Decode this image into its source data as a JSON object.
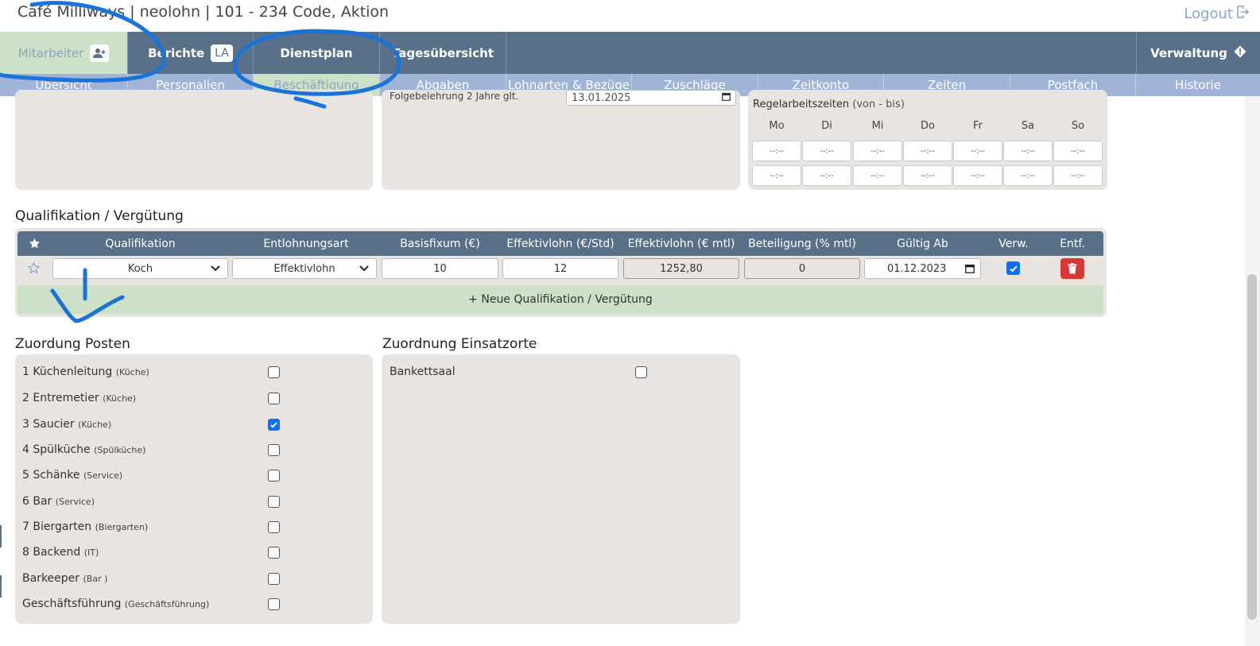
{
  "header": {
    "title": "Café Milliways | neolohn | 101 - 234 Code, Aktion",
    "logout_label": "Logout"
  },
  "mainnav": {
    "mitarbeiter": "Mitarbeiter",
    "berichte": "Berichte",
    "berichte_badge": "LA",
    "dienstplan": "Dienstplan",
    "tagesuebersicht": "Tagesübersicht",
    "verwaltung": "Verwaltung"
  },
  "subnav": [
    "Übersicht",
    "Personalien",
    "Beschäftigung",
    "Abgaben",
    "Lohnarten & Bezüge",
    "Zuschläge",
    "Zeitkonto",
    "Zeiten",
    "Postfach",
    "Historie"
  ],
  "top_fragment": {
    "label": "Folgebelehrung 2 Jahre glt.",
    "date": "13.01.2025"
  },
  "regelarbeitszeiten": {
    "title": "Regelarbeitszeiten",
    "suffix": "(von - bis)",
    "days": [
      "Mo",
      "Di",
      "Mi",
      "Do",
      "Fr",
      "Sa",
      "So"
    ],
    "placeholder": "--:--"
  },
  "qualifikation": {
    "section_title": "Qualifikation / Vergütung",
    "headers": {
      "qualifikation": "Qualifikation",
      "entlohnungsart": "Entlohnungsart",
      "basisfixum": "Basisfixum (€)",
      "effektivlohn_std": "Effektivlohn (€/Std)",
      "effektivlohn_mtl": "Effektivlohn (€ mtl)",
      "beteiligung": "Beteiligung (% mtl)",
      "gueltig_ab": "Gültig Ab",
      "verw": "Verw.",
      "entf": "Entf."
    },
    "row": {
      "qualifikation": "Koch",
      "entlohnungsart": "Effektivlohn",
      "basisfixum": "10",
      "effektivlohn_std": "12",
      "effektivlohn_mtl": "1252,80",
      "beteiligung": "0",
      "gueltig_ab": "01.12.2023",
      "verw_checked": true
    },
    "add_label": "+ Neue Qualifikation / Vergütung"
  },
  "posten": {
    "section_title": "Zuordung Posten",
    "items": [
      {
        "name": "1 Küchenleitung",
        "group": "(Küche)",
        "checked": false
      },
      {
        "name": "2 Entremetier",
        "group": "(Küche)",
        "checked": false
      },
      {
        "name": "3 Saucier",
        "group": "(Küche)",
        "checked": true
      },
      {
        "name": "4 Spülküche",
        "group": "(Spülküche)",
        "checked": false
      },
      {
        "name": "5 Schänke",
        "group": "(Service)",
        "checked": false
      },
      {
        "name": "6 Bar",
        "group": "(Service)",
        "checked": false
      },
      {
        "name": "7 Biergarten",
        "group": "(Biergarten)",
        "checked": false
      },
      {
        "name": "8 Backend",
        "group": "(IT)",
        "checked": false
      },
      {
        "name": "Barkeeper",
        "group": "(Bar )",
        "checked": false
      },
      {
        "name": "Geschäftsführung",
        "group": "(Geschäftsführung)",
        "checked": false
      }
    ]
  },
  "einsatzorte": {
    "section_title": "Zuordnung Einsatzorte",
    "items": [
      {
        "name": "Bankettsaal",
        "checked": false
      }
    ]
  },
  "colors": {
    "nav": "#587088",
    "subnav": "#9fb4d6",
    "active_tab": "#cde0c8",
    "panel": "#e8e5e1",
    "annotation_ink": "#1a73d9",
    "delete": "#d93636",
    "checkbox": "#0d6efd"
  }
}
